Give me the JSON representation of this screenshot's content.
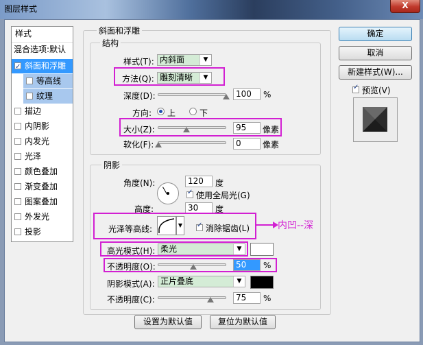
{
  "window": {
    "title": "图层样式",
    "close_label": "X"
  },
  "left_panel": {
    "header": "样式",
    "blend_options": "混合选项:默认",
    "items": [
      {
        "label": "斜面和浮雕",
        "checked": true,
        "selected": true
      },
      {
        "label": "等高线",
        "checked": false,
        "sub": true
      },
      {
        "label": "纹理",
        "checked": false,
        "sub": true
      },
      {
        "label": "描边",
        "checked": false
      },
      {
        "label": "内阴影",
        "checked": false
      },
      {
        "label": "内发光",
        "checked": false
      },
      {
        "label": "光泽",
        "checked": false
      },
      {
        "label": "颜色叠加",
        "checked": false
      },
      {
        "label": "渐变叠加",
        "checked": false
      },
      {
        "label": "图案叠加",
        "checked": false
      },
      {
        "label": "外发光",
        "checked": false
      },
      {
        "label": "投影",
        "checked": false
      }
    ]
  },
  "bevel": {
    "section_title": "斜面和浮雕",
    "structure_title": "结构",
    "style_label": "样式(T):",
    "style_value": "内斜面",
    "technique_label": "方法(Q):",
    "technique_value": "雕刻清晰",
    "depth_label": "深度(D):",
    "depth_value": "100",
    "depth_unit": "%",
    "direction_label": "方向:",
    "direction_up": "上",
    "direction_down": "下",
    "size_label": "大小(Z):",
    "size_value": "95",
    "size_unit": "像素",
    "soften_label": "软化(F):",
    "soften_value": "0",
    "soften_unit": "像素"
  },
  "shading": {
    "title": "阴影",
    "angle_label": "角度(N):",
    "angle_value": "120",
    "angle_unit": "度",
    "global_light_label": "使用全局光(G)",
    "altitude_label": "高度:",
    "altitude_value": "30",
    "altitude_unit": "度",
    "gloss_contour_label": "光泽等高线:",
    "anti_alias_label": "消除锯齿(L)",
    "highlight_mode_label": "高光模式(H):",
    "highlight_mode_value": "柔光",
    "highlight_opacity_label": "不透明度(O):",
    "highlight_opacity_value": "50",
    "highlight_opacity_unit": "%",
    "shadow_mode_label": "阴影模式(A):",
    "shadow_mode_value": "正片叠底",
    "shadow_opacity_label": "不透明度(C):",
    "shadow_opacity_value": "75",
    "shadow_opacity_unit": "%"
  },
  "annotation": "内凹--深",
  "buttons": {
    "make_default": "设置为默认值",
    "reset_default": "复位为默认值",
    "ok": "确定",
    "cancel": "取消",
    "new_style": "新建样式(W)...",
    "preview": "预览(V)"
  },
  "colors": {
    "highlight_swatch": "#ffffff",
    "shadow_swatch": "#000000",
    "annotation": "#d21fd2"
  }
}
